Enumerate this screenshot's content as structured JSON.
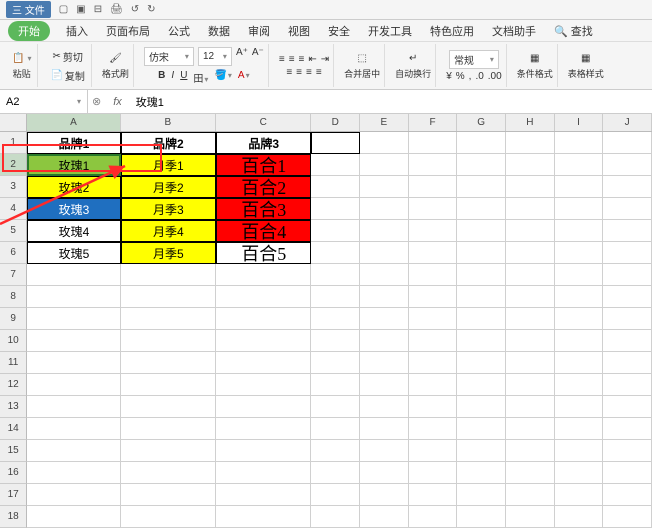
{
  "titlebar": {
    "menu": "三 文件",
    "icons": [
      "□",
      "▣",
      "⊟",
      "⎙",
      "↺",
      "↻"
    ]
  },
  "tabs": {
    "items": [
      "开始",
      "插入",
      "页面布局",
      "公式",
      "数据",
      "审阅",
      "视图",
      "安全",
      "开发工具",
      "特色应用",
      "文档助手"
    ],
    "search_label": "查找",
    "active_index": 0
  },
  "ribbon": {
    "cut": "剪切",
    "copy": "复制",
    "format_painter": "格式刷",
    "font_name": "仿宋",
    "font_size": "12",
    "merge": "合并居中",
    "wrap": "自动换行",
    "general": "常规",
    "cond_fmt": "条件格式",
    "table_style": "表格样式"
  },
  "namebox": "A2",
  "formula": "玫瑰1",
  "fx_label": "fx",
  "paste_label": "粘贴",
  "cols": [
    "A",
    "B",
    "C",
    "D",
    "E",
    "F",
    "G",
    "H",
    "I",
    "J"
  ],
  "col_widths": [
    "wA",
    "wB",
    "wC",
    "wSm",
    "wSm",
    "wSm",
    "wSm",
    "wSm",
    "wSm",
    "wSm"
  ],
  "row_count": 18,
  "table": {
    "headers": [
      "品牌1",
      "品牌2",
      "品牌3"
    ],
    "rows": [
      {
        "a": "玫瑰1",
        "b": "月季1",
        "c": "百合1",
        "a_bg": "#8cc63f",
        "b_bg": "#ffff00",
        "c_bg": "#ff0000"
      },
      {
        "a": "玫瑰2",
        "b": "月季2",
        "c": "百合2",
        "a_bg": "#ffff00",
        "b_bg": "#ffff00",
        "c_bg": "#ff0000"
      },
      {
        "a": "玫瑰3",
        "b": "月季3",
        "c": "百合3",
        "a_bg": "#1f6fc0",
        "b_bg": "#ffff00",
        "c_bg": "#ff0000"
      },
      {
        "a": "玫瑰4",
        "b": "月季4",
        "c": "百合4",
        "a_bg": "#ffffff",
        "b_bg": "#ffff00",
        "c_bg": "#ff0000"
      },
      {
        "a": "玫瑰5",
        "b": "月季5",
        "c": "百合5",
        "a_bg": "#ffffff",
        "b_bg": "#ffff00",
        "c_bg": "#ffffff"
      }
    ]
  },
  "chart_data": {
    "type": "table",
    "title": "",
    "columns": [
      "品牌1",
      "品牌2",
      "品牌3"
    ],
    "rows": [
      [
        "玫瑰1",
        "月季1",
        "百合1"
      ],
      [
        "玫瑰2",
        "月季2",
        "百合2"
      ],
      [
        "玫瑰3",
        "月季3",
        "百合3"
      ],
      [
        "玫瑰4",
        "月季4",
        "百合4"
      ],
      [
        "玫瑰5",
        "月季5",
        "百合5"
      ]
    ]
  }
}
